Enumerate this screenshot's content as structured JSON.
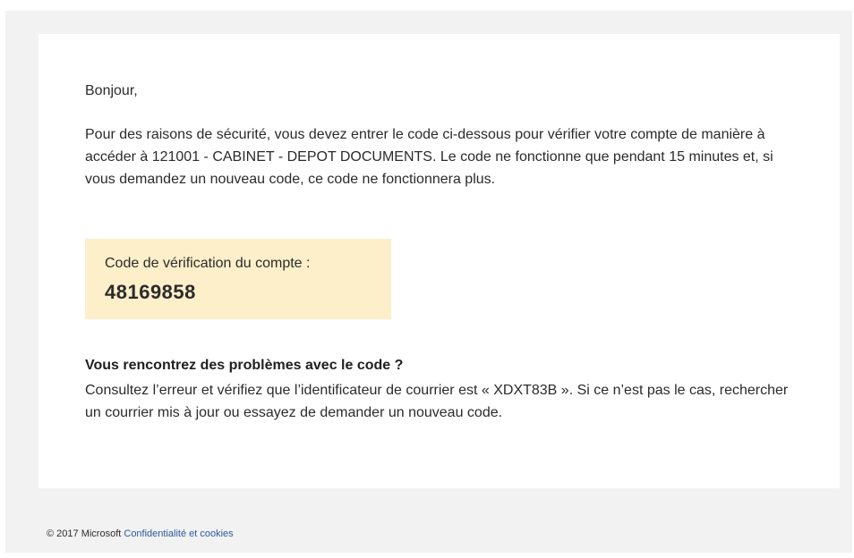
{
  "email": {
    "greeting": "Bonjour,",
    "intro": "Pour des raisons de sécurité, vous devez entrer le code ci-dessous pour vérifier votre compte de manière à accéder à 121001 - CABINET - DEPOT DOCUMENTS. Le code ne fonctionne que pendant 15 minutes et, si vous demandez un nouveau code, ce code ne fonctionnera plus.",
    "code_box": {
      "label": "Code de vérification du compte :",
      "code": "48169858"
    },
    "problem": {
      "title": "Vous rencontrez des problèmes avec le code ?",
      "text": "Consultez l’erreur et vérifiez que l’identificateur de courrier est « XDXT83B ». Si ce n’est pas le cas, rechercher un courrier mis à jour ou essayez de demander un nouveau code."
    }
  },
  "footer": {
    "copyright": "© 2017 Microsoft",
    "privacy_link": "Confidentialité et cookies"
  },
  "colors": {
    "background": "#f2f2f2",
    "card": "#ffffff",
    "code_highlight": "#fcefc9",
    "link": "#2a5a9e",
    "text": "#2b2b2b"
  }
}
